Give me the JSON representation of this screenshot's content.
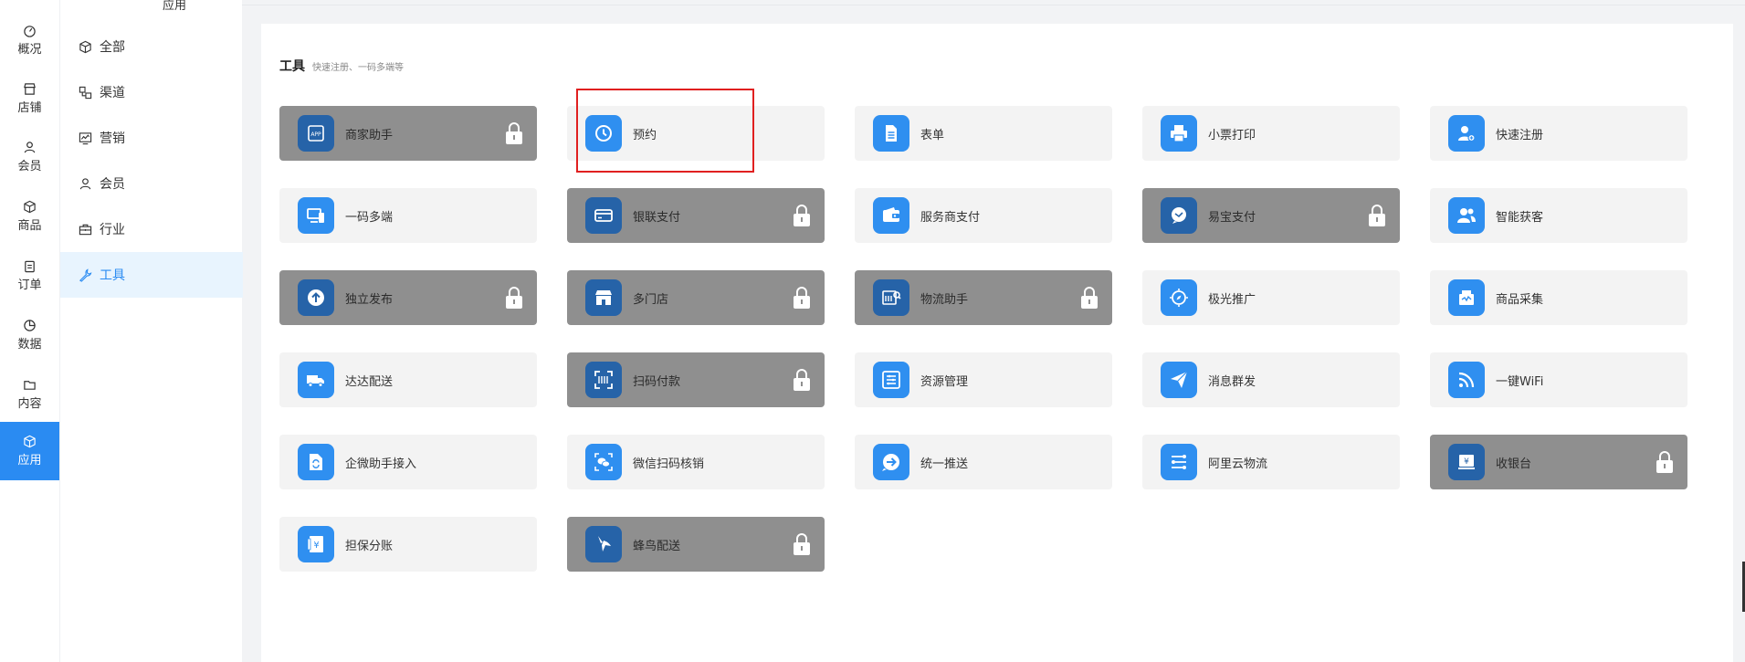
{
  "rail": {
    "items": [
      {
        "label": "概况",
        "icon": "dashboard-icon"
      },
      {
        "label": "店铺",
        "icon": "store-icon"
      },
      {
        "label": "会员",
        "icon": "member-icon"
      },
      {
        "label": "商品",
        "icon": "goods-box-icon"
      },
      {
        "label": "订单",
        "icon": "order-clipboard-icon"
      },
      {
        "label": "数据",
        "icon": "pie-chart-icon"
      },
      {
        "label": "内容",
        "icon": "folder-icon"
      },
      {
        "label": "应用",
        "icon": "app-cube-icon",
        "active": true
      }
    ]
  },
  "subnav": {
    "title": "应用",
    "items": [
      {
        "label": "全部",
        "icon": "cube-icon"
      },
      {
        "label": "渠道",
        "icon": "channel-icon"
      },
      {
        "label": "营销",
        "icon": "marketing-monitor-icon"
      },
      {
        "label": "会员",
        "icon": "user-icon"
      },
      {
        "label": "行业",
        "icon": "briefcase-icon"
      },
      {
        "label": "工具",
        "icon": "wrench-icon",
        "active": true
      }
    ]
  },
  "section": {
    "title": "工具",
    "subtitle": "快速注册、一码多端等"
  },
  "tools": [
    {
      "label": "商家助手",
      "locked": true,
      "icon": "app-icon"
    },
    {
      "label": "预约",
      "locked": false,
      "icon": "clock-icon"
    },
    {
      "label": "表单",
      "locked": false,
      "icon": "document-icon"
    },
    {
      "label": "小票打印",
      "locked": false,
      "icon": "printer-icon"
    },
    {
      "label": "快速注册",
      "locked": false,
      "icon": "user-add-icon"
    },
    {
      "label": "一码多端",
      "locked": false,
      "icon": "devices-icon"
    },
    {
      "label": "银联支付",
      "locked": true,
      "icon": "card-icon"
    },
    {
      "label": "服务商支付",
      "locked": false,
      "icon": "wallet-icon"
    },
    {
      "label": "易宝支付",
      "locked": true,
      "icon": "chat-icon"
    },
    {
      "label": "智能获客",
      "locked": false,
      "icon": "users-icon"
    },
    {
      "label": "独立发布",
      "locked": true,
      "icon": "upload-icon"
    },
    {
      "label": "多门店",
      "locked": true,
      "icon": "store-front-icon"
    },
    {
      "label": "物流助手",
      "locked": true,
      "icon": "logistics-icon"
    },
    {
      "label": "极光推广",
      "locked": false,
      "icon": "compass-icon"
    },
    {
      "label": "商品采集",
      "locked": false,
      "icon": "collect-icon"
    },
    {
      "label": "达达配送",
      "locked": false,
      "icon": "truck-icon"
    },
    {
      "label": "扫码付款",
      "locked": true,
      "icon": "scan-icon"
    },
    {
      "label": "资源管理",
      "locked": false,
      "icon": "list-icon"
    },
    {
      "label": "消息群发",
      "locked": false,
      "icon": "send-icon"
    },
    {
      "label": "一键WiFi",
      "locked": false,
      "icon": "wifi-icon"
    },
    {
      "label": "企微助手接入",
      "locked": false,
      "icon": "refresh-file-icon"
    },
    {
      "label": "微信扫码核销",
      "locked": false,
      "icon": "wechat-scan-icon"
    },
    {
      "label": "统一推送",
      "locked": false,
      "icon": "arrow-circle-icon"
    },
    {
      "label": "阿里云物流",
      "locked": false,
      "icon": "route-icon"
    },
    {
      "label": "收银台",
      "locked": true,
      "icon": "cashier-icon"
    },
    {
      "label": "担保分账",
      "locked": false,
      "icon": "yuan-icon"
    },
    {
      "label": "蜂鸟配送",
      "locked": true,
      "icon": "bird-icon"
    }
  ],
  "colors": {
    "accent": "#2a8bf2",
    "locked_card": "#8f8f8f",
    "card": "#f3f3f3",
    "highlight": "#e02020"
  }
}
